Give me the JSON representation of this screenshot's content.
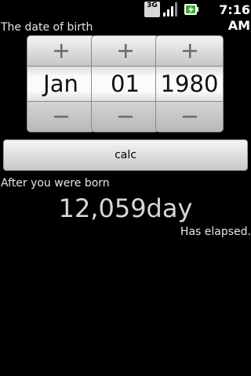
{
  "status_bar": {
    "network_badge": "3G",
    "time": "7:16 AM",
    "icons": [
      "3g-icon",
      "signal-icon",
      "battery-charging-icon"
    ]
  },
  "date_picker": {
    "label": "The date of birth",
    "increment_symbol": "+",
    "decrement_symbol": "−",
    "month": "Jan",
    "day": "01",
    "year": "1980"
  },
  "calc_button": {
    "label": "calc"
  },
  "result": {
    "prefix_label": "After you were born",
    "value": "12,059day",
    "suffix_label": "Has elapsed."
  },
  "colors": {
    "background": "#000000",
    "text": "#e6e6e6",
    "result_text": "#d6d6d6"
  }
}
